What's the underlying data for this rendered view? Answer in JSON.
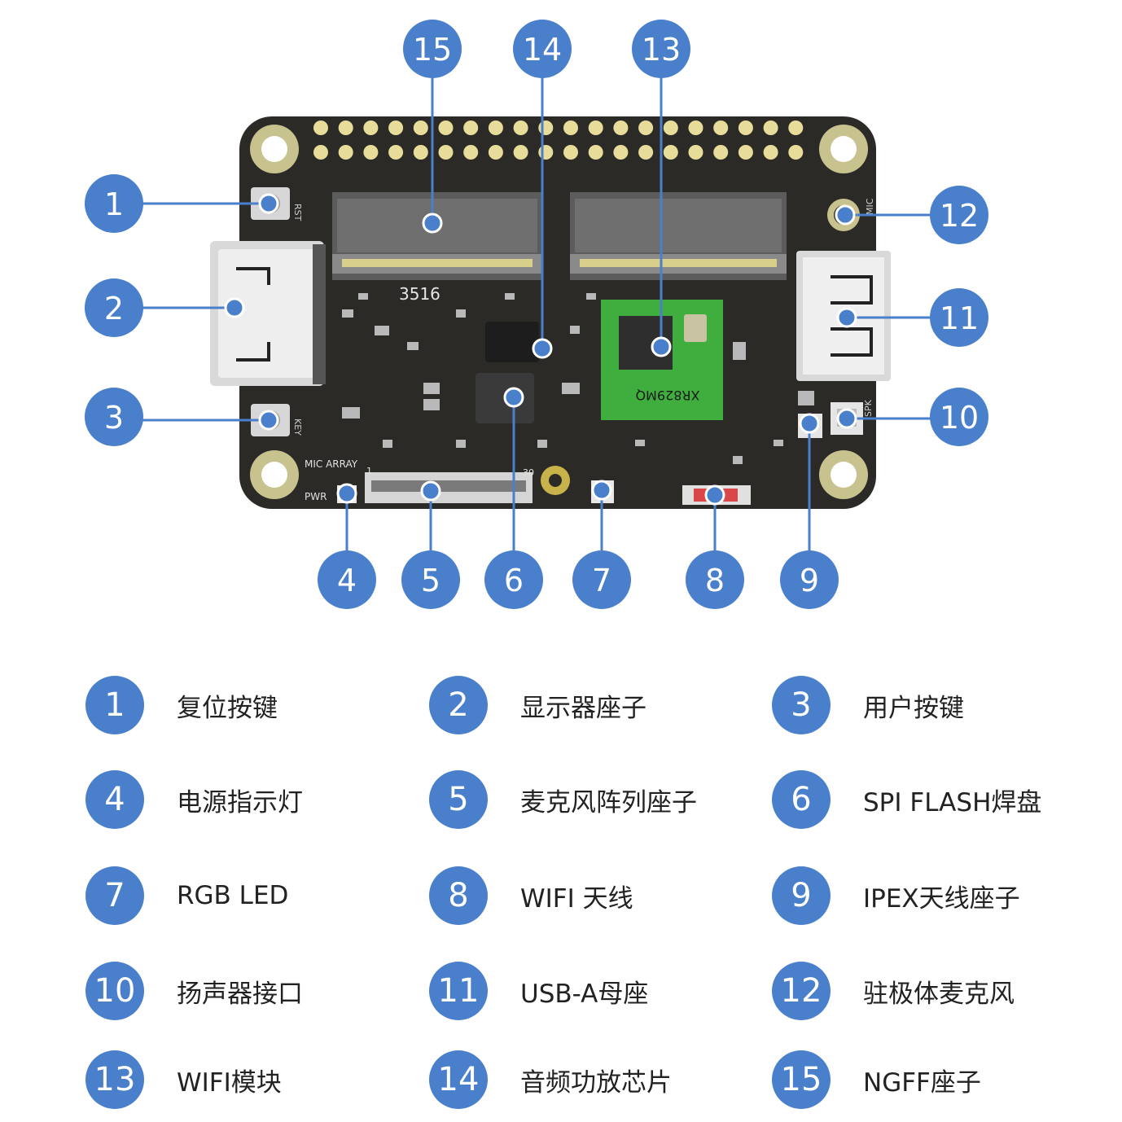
{
  "colors": {
    "badge": "#4a7fcc",
    "board": "#2b2a27",
    "wifi_module": "#3fae3f",
    "gold": "#e8dc9a"
  },
  "board": {
    "silkscreen_rst": "RST",
    "silkscreen_key": "KEY",
    "silkscreen_mic": "MIC",
    "silkscreen_spk": "SPK",
    "silkscreen_pwr": "PWR",
    "silkscreen_mic_array": "MIC ARRAY",
    "silkscreen_pin_first": "1",
    "silkscreen_pin_last": "30",
    "chip_label_3516": "3516",
    "wifi_label": "XR829MQ"
  },
  "callouts": [
    "1",
    "2",
    "3",
    "4",
    "5",
    "6",
    "7",
    "8",
    "9",
    "10",
    "11",
    "12",
    "13",
    "14",
    "15"
  ],
  "legend": [
    {
      "num": "1",
      "label": "复位按键"
    },
    {
      "num": "2",
      "label": "显示器座子"
    },
    {
      "num": "3",
      "label": "用户按键"
    },
    {
      "num": "4",
      "label": "电源指示灯"
    },
    {
      "num": "5",
      "label": "麦克风阵列座子"
    },
    {
      "num": "6",
      "label": "SPI FLASH焊盘"
    },
    {
      "num": "7",
      "label": "RGB LED"
    },
    {
      "num": "8",
      "label": "WIFI 天线"
    },
    {
      "num": "9",
      "label": "IPEX天线座子"
    },
    {
      "num": "10",
      "label": "扬声器接口"
    },
    {
      "num": "11",
      "label": "USB-A母座"
    },
    {
      "num": "12",
      "label": "驻极体麦克风"
    },
    {
      "num": "13",
      "label": "WIFI模块"
    },
    {
      "num": "14",
      "label": "音频功放芯片"
    },
    {
      "num": "15",
      "label": "NGFF座子"
    }
  ]
}
